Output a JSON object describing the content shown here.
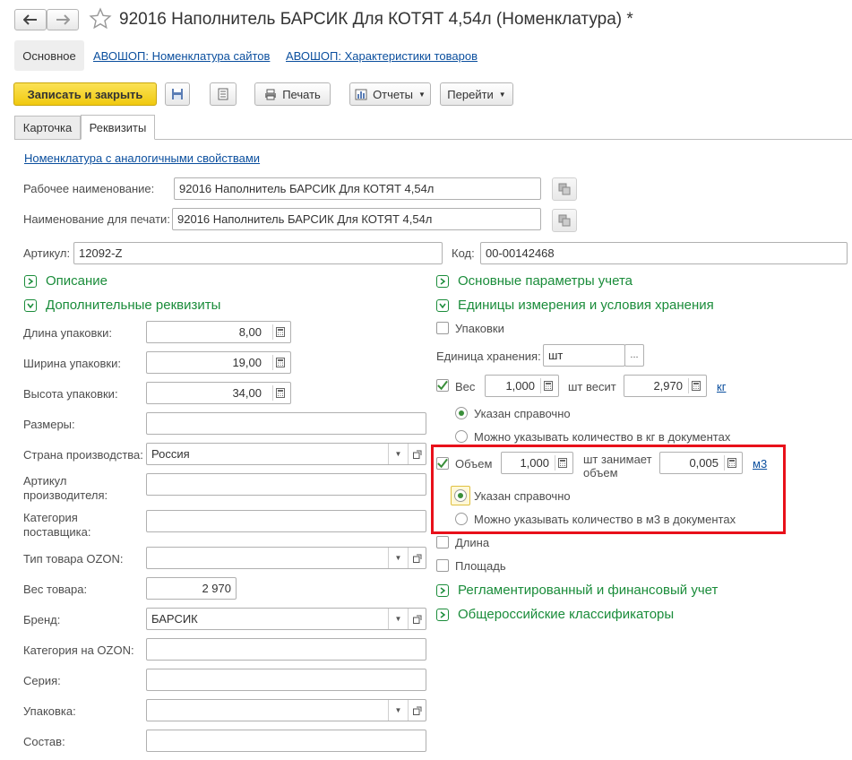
{
  "window": {
    "title": "92016 Наполнитель БАРСИК Для КОТЯТ 4,54л (Номенклатура) *"
  },
  "nav_tabs": {
    "main": "Основное",
    "link1": "АВОШОП: Номенклатура сайтов",
    "link2": "АВОШОП: Характеристики товаров"
  },
  "toolbar": {
    "save_close": "Записать и закрыть",
    "print": "Печать",
    "reports": "Отчеты",
    "goto": "Перейти"
  },
  "form_tabs": {
    "card": "Карточка",
    "requisites": "Реквизиты"
  },
  "similar_link": "Номенклатура с аналогичными свойствами",
  "names": {
    "work_label": "Рабочее наименование:",
    "work_value": "92016 Наполнитель БАРСИК Для КОТЯТ 4,54л",
    "print_label": "Наименование для печати:",
    "print_value": "92016 Наполнитель БАРСИК Для КОТЯТ 4,54л"
  },
  "article": {
    "label": "Артикул:",
    "value": "12092-Z"
  },
  "code": {
    "label": "Код:",
    "value": "00-00142468"
  },
  "sections": {
    "description": "Описание",
    "additional": "Дополнительные реквизиты",
    "basic_params": "Основные параметры учета",
    "units": "Единицы измерения и условия хранения",
    "regulated": "Регламентированный и финансовый учет",
    "classifiers": "Общероссийские классификаторы"
  },
  "left_fields": {
    "length_label": "Длина упаковки:",
    "length_value": "8,00",
    "width_label": "Ширина упаковки:",
    "width_value": "19,00",
    "height_label": "Высота упаковки:",
    "height_value": "34,00",
    "sizes_label": "Размеры:",
    "sizes_value": "",
    "country_label": "Страна производства:",
    "country_value": "Россия",
    "mfr_article_label": "Артикул производителя:",
    "mfr_article_value": "",
    "supplier_cat_label": "Категория поставщика:",
    "supplier_cat_value": "",
    "ozon_type_label": "Тип товара OZON:",
    "ozon_type_value": "",
    "weight_label": "Вес товара:",
    "weight_value": "2 970",
    "brand_label": "Бренд:",
    "brand_value": "БАРСИК",
    "ozon_cat_label": "Категория на OZON:",
    "ozon_cat_value": "",
    "series_label": "Серия:",
    "series_value": "",
    "packaging_label": "Упаковка:",
    "packaging_value": "",
    "composition_label": "Состав:",
    "composition_value": ""
  },
  "units": {
    "packages_label": "Упаковки",
    "storage_unit_label": "Единица хранения:",
    "storage_unit_value": "шт",
    "storage_unit_btn": "...",
    "weight_label": "Вес",
    "weight_qty": "1,000",
    "weight_mid": "шт весит",
    "weight_value": "2,970",
    "weight_unit": "кг",
    "weight_radio1": "Указан справочно",
    "weight_radio2": "Можно указывать количество в кг в документах",
    "volume_label": "Объем",
    "volume_qty": "1,000",
    "volume_mid": "шт занимает объем",
    "volume_value": "0,005",
    "volume_unit": "м3",
    "volume_radio1": "Указан справочно",
    "volume_radio2": "Можно указывать количество в м3 в документах",
    "length_label": "Длина",
    "area_label": "Площадь"
  },
  "colors": {
    "accent_yellow": "#f5d31f",
    "green": "#1a8c3a",
    "highlight": "#e8101a",
    "link": "#0b4f9e"
  }
}
